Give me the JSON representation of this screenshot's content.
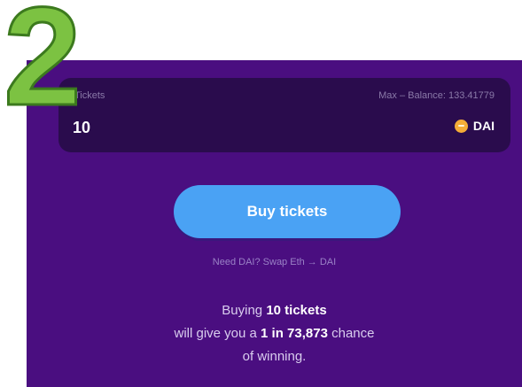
{
  "overlay": {
    "step_number": "2",
    "step_color": "#7cc242"
  },
  "tickets_box": {
    "label": "Tickets",
    "max_balance": "Max – Balance: 133.41779",
    "value": "10",
    "token_icon": "dai-icon",
    "token_symbol": "DAI"
  },
  "actions": {
    "buy_label": "Buy tickets",
    "swap_link": "Need DAI? Swap Eth → DAI"
  },
  "summary": {
    "line1_prefix": "Buying ",
    "line1_bold": "10 tickets",
    "line2_prefix": "will give you a ",
    "line2_bold": "1 in 73,873",
    "line2_suffix": " chance",
    "line3": "of winning."
  },
  "colors": {
    "panel_bg": "#4a0e80",
    "input_box_bg": "#2a0c4d",
    "button_bg": "#4aa2f4",
    "dai_icon": "#f5ac37"
  }
}
